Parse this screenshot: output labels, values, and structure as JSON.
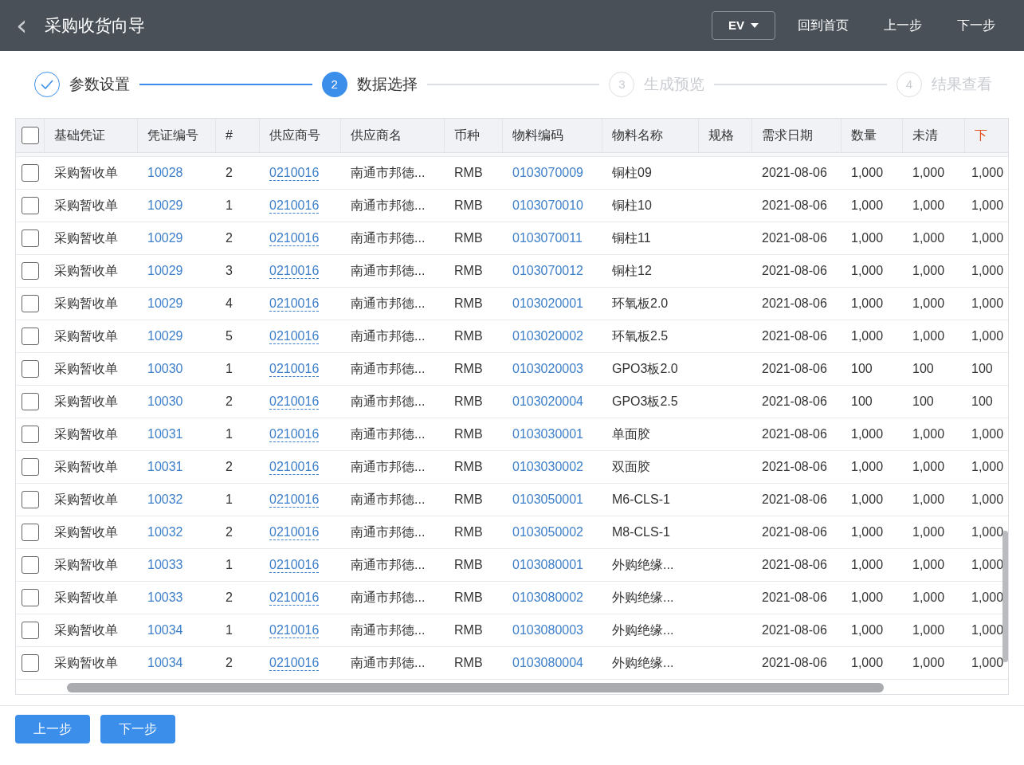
{
  "header": {
    "back": "‹",
    "title": "采购收货向导",
    "org_select": "EV",
    "actions": [
      "回到首页",
      "上一步",
      "下一步"
    ]
  },
  "steps": [
    {
      "kind": "done",
      "label": "参数设置",
      "selected": false
    },
    {
      "kind": "numbered",
      "number": "2",
      "label": "数据选择",
      "selected": true
    },
    {
      "kind": "numbered",
      "number": "3",
      "label": "生成预览",
      "selected": false
    },
    {
      "kind": "numbered",
      "number": "4",
      "label": "结果查看",
      "selected": false
    }
  ],
  "table": {
    "all_selected": false,
    "columns": [
      {
        "label": "基础凭证",
        "kind": "text"
      },
      {
        "label": "凭证编号",
        "kind": "link"
      },
      {
        "label": "#",
        "kind": "text"
      },
      {
        "label": "供应商号",
        "kind": "dashed-link"
      },
      {
        "label": "供应商名",
        "kind": "text"
      },
      {
        "label": "币种",
        "kind": "text"
      },
      {
        "label": "物料编码",
        "kind": "link"
      },
      {
        "label": "物料名称",
        "kind": "text"
      },
      {
        "label": "规格"
      },
      {
        "label": "需求日期",
        "kind": "text"
      },
      {
        "label": "数量",
        "kind": "text"
      },
      {
        "label": "未清",
        "kind": "text"
      },
      {
        "label": "下",
        "kind": "text",
        "highlight": true
      }
    ],
    "rows": [
      {
        "selected": false,
        "cells": [
          "采购暂收单",
          "10028",
          "2",
          "0210016",
          "南通市邦德...",
          "RMB",
          "0103070009",
          "铜柱09",
          "",
          "2021-08-06",
          "1,000",
          "1,000",
          "1,000"
        ]
      },
      {
        "selected": false,
        "cells": [
          "采购暂收单",
          "10029",
          "1",
          "0210016",
          "南通市邦德...",
          "RMB",
          "0103070010",
          "铜柱10",
          "",
          "2021-08-06",
          "1,000",
          "1,000",
          "1,000"
        ]
      },
      {
        "selected": false,
        "cells": [
          "采购暂收单",
          "10029",
          "2",
          "0210016",
          "南通市邦德...",
          "RMB",
          "0103070011",
          "铜柱11",
          "",
          "2021-08-06",
          "1,000",
          "1,000",
          "1,000"
        ]
      },
      {
        "selected": false,
        "cells": [
          "采购暂收单",
          "10029",
          "3",
          "0210016",
          "南通市邦德...",
          "RMB",
          "0103070012",
          "铜柱12",
          "",
          "2021-08-06",
          "1,000",
          "1,000",
          "1,000"
        ]
      },
      {
        "selected": false,
        "cells": [
          "采购暂收单",
          "10029",
          "4",
          "0210016",
          "南通市邦德...",
          "RMB",
          "0103020001",
          "环氧板2.0",
          "",
          "2021-08-06",
          "1,000",
          "1,000",
          "1,000"
        ]
      },
      {
        "selected": false,
        "cells": [
          "采购暂收单",
          "10029",
          "5",
          "0210016",
          "南通市邦德...",
          "RMB",
          "0103020002",
          "环氧板2.5",
          "",
          "2021-08-06",
          "1,000",
          "1,000",
          "1,000"
        ]
      },
      {
        "selected": false,
        "cells": [
          "采购暂收单",
          "10030",
          "1",
          "0210016",
          "南通市邦德...",
          "RMB",
          "0103020003",
          "GPO3板2.0",
          "",
          "2021-08-06",
          "100",
          "100",
          "100"
        ]
      },
      {
        "selected": false,
        "cells": [
          "采购暂收单",
          "10030",
          "2",
          "0210016",
          "南通市邦德...",
          "RMB",
          "0103020004",
          "GPO3板2.5",
          "",
          "2021-08-06",
          "100",
          "100",
          "100"
        ]
      },
      {
        "selected": false,
        "cells": [
          "采购暂收单",
          "10031",
          "1",
          "0210016",
          "南通市邦德...",
          "RMB",
          "0103030001",
          "单面胶",
          "",
          "2021-08-06",
          "1,000",
          "1,000",
          "1,000"
        ]
      },
      {
        "selected": false,
        "cells": [
          "采购暂收单",
          "10031",
          "2",
          "0210016",
          "南通市邦德...",
          "RMB",
          "0103030002",
          "双面胶",
          "",
          "2021-08-06",
          "1,000",
          "1,000",
          "1,000"
        ]
      },
      {
        "selected": false,
        "cells": [
          "采购暂收单",
          "10032",
          "1",
          "0210016",
          "南通市邦德...",
          "RMB",
          "0103050001",
          "M6-CLS-1",
          "",
          "2021-08-06",
          "1,000",
          "1,000",
          "1,000"
        ]
      },
      {
        "selected": false,
        "cells": [
          "采购暂收单",
          "10032",
          "2",
          "0210016",
          "南通市邦德...",
          "RMB",
          "0103050002",
          "M8-CLS-1",
          "",
          "2021-08-06",
          "1,000",
          "1,000",
          "1,000"
        ]
      },
      {
        "selected": false,
        "cells": [
          "采购暂收单",
          "10033",
          "1",
          "0210016",
          "南通市邦德...",
          "RMB",
          "0103080001",
          "外购绝缘...",
          "",
          "2021-08-06",
          "1,000",
          "1,000",
          "1,000"
        ]
      },
      {
        "selected": false,
        "cells": [
          "采购暂收单",
          "10033",
          "2",
          "0210016",
          "南通市邦德...",
          "RMB",
          "0103080002",
          "外购绝缘...",
          "",
          "2021-08-06",
          "1,000",
          "1,000",
          "1,000"
        ]
      },
      {
        "selected": false,
        "cells": [
          "采购暂收单",
          "10034",
          "1",
          "0210016",
          "南通市邦德...",
          "RMB",
          "0103080003",
          "外购绝缘...",
          "",
          "2021-08-06",
          "1,000",
          "1,000",
          "1,000"
        ]
      },
      {
        "selected": false,
        "cells": [
          "采购暂收单",
          "10034",
          "2",
          "0210016",
          "南通市邦德...",
          "RMB",
          "0103080004",
          "外购绝缘...",
          "",
          "2021-08-06",
          "1,000",
          "1,000",
          "1,000"
        ]
      }
    ]
  },
  "footer_buttons": [
    "上一步",
    "下一步"
  ]
}
